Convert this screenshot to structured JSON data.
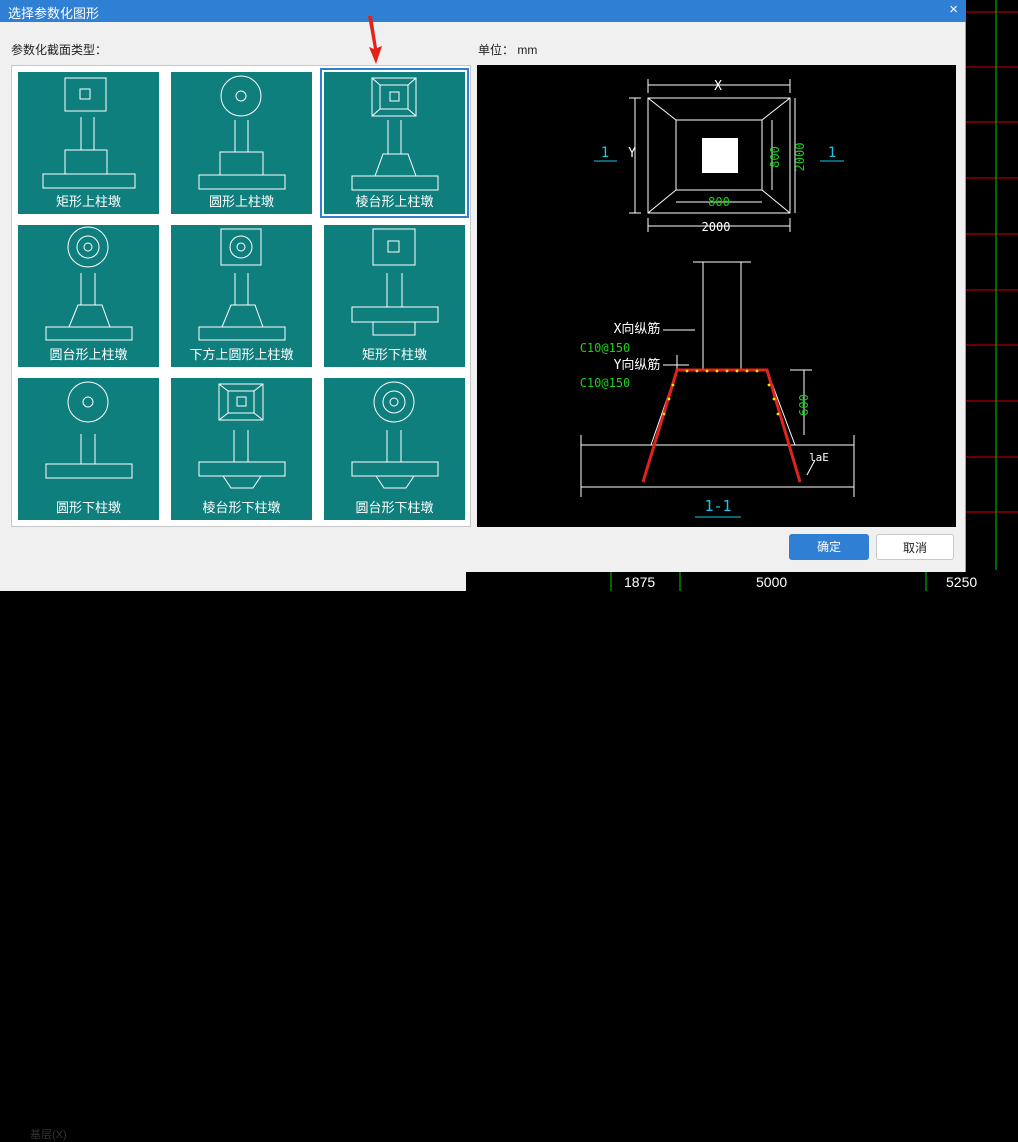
{
  "dialog": {
    "title": "选择参数化图形",
    "close_glyph": "×",
    "section_label": "参数化截面类型：",
    "unit_label": "单位：  mm",
    "ok_label": "确定",
    "cancel_label": "取消"
  },
  "shapes": [
    {
      "label": "矩形上柱墩",
      "selected": false
    },
    {
      "label": "圆形上柱墩",
      "selected": false
    },
    {
      "label": "棱台形上柱墩",
      "selected": true
    },
    {
      "label": "圆台形上柱墩",
      "selected": false
    },
    {
      "label": "下方上圆形上柱墩",
      "selected": false
    },
    {
      "label": "矩形下柱墩",
      "selected": false
    },
    {
      "label": "圆形下柱墩",
      "selected": false
    },
    {
      "label": "棱台形下柱墩",
      "selected": false
    },
    {
      "label": "圆台形下柱墩",
      "selected": false
    }
  ],
  "preview": {
    "x_label": "X",
    "y_label": "Y",
    "dim_inner_w": "800",
    "dim_inner_h": "800",
    "dim_outer_w": "2000",
    "dim_outer_h": "2000",
    "section_mark_left": "1",
    "section_mark_right": "1",
    "x_rebar_label": "X向纵筋",
    "x_rebar_value": "C10@150",
    "y_rebar_label": "Y向纵筋",
    "y_rebar_value": "C10@150",
    "height_dim": "600",
    "lae_label": "laE",
    "section_title": "1-1"
  },
  "background": {
    "tail_text": "基层(X)",
    "numbers": [
      "1875",
      "5000",
      "5250"
    ]
  }
}
